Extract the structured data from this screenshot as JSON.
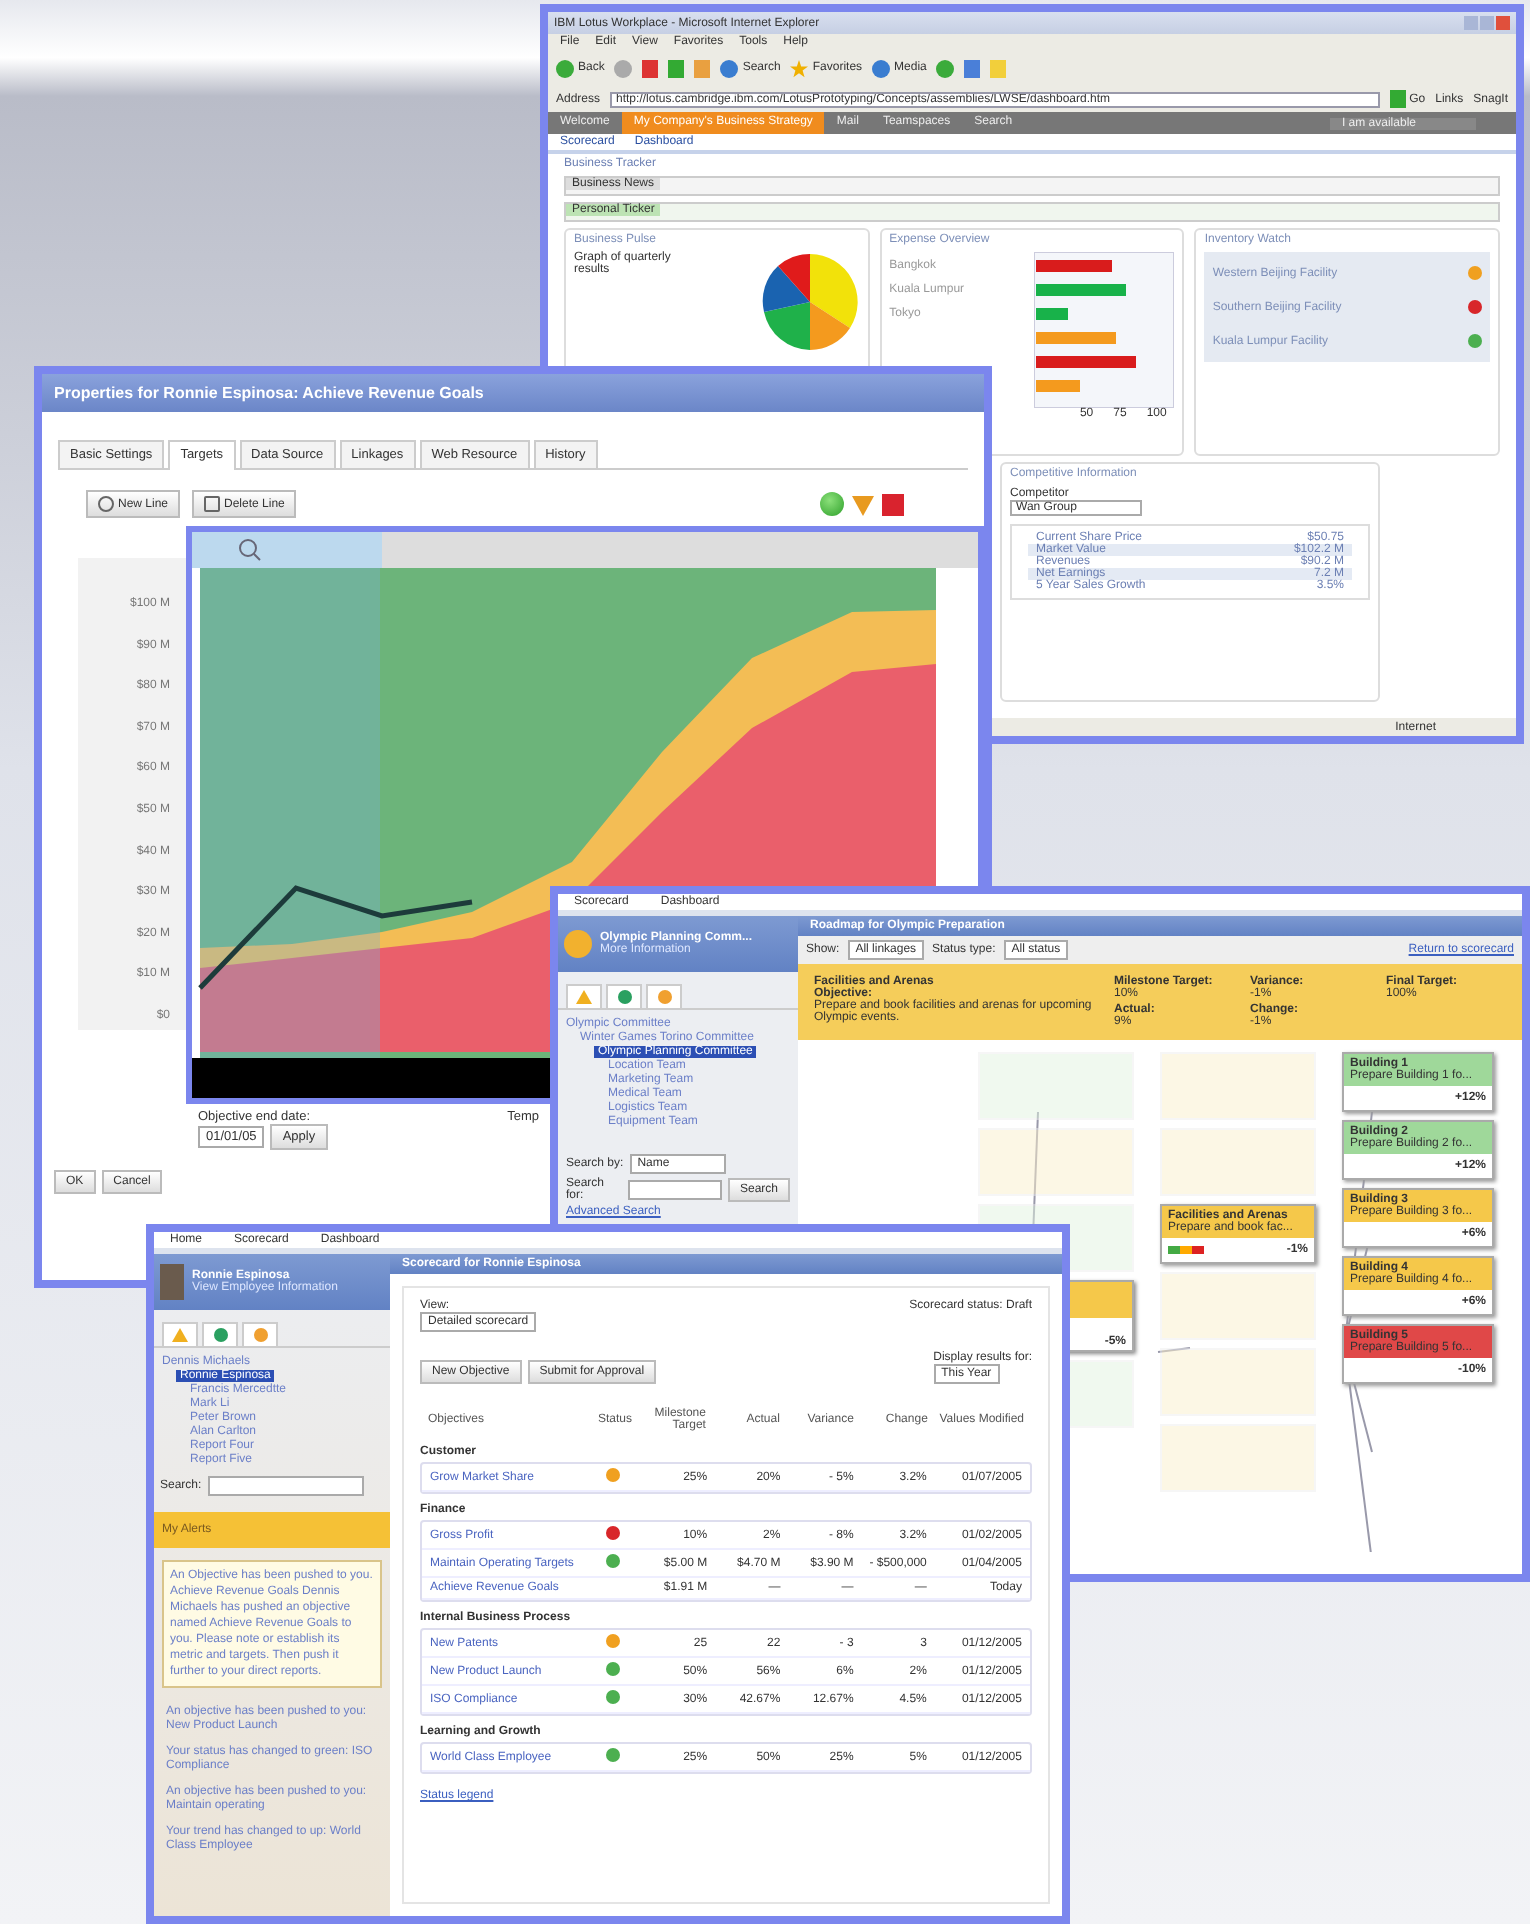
{
  "browser_window": {
    "title": "IBM Lotus Workplace - Microsoft Internet Explorer",
    "menu": [
      "File",
      "Edit",
      "View",
      "Favorites",
      "Tools",
      "Help"
    ],
    "toolbar": [
      "Back",
      "Search",
      "Favorites",
      "Media"
    ],
    "address_label": "Address",
    "address": "http://lotus.cambridge.ibm.com/LotusPrototyping/Concepts/assemblies/LWSE/dashboard.htm",
    "go": "Go",
    "links": "Links",
    "snagit": "SnagIt",
    "nav_tabs": [
      {
        "label": "Welcome",
        "selected": false
      },
      {
        "label": "My Company's Business Strategy",
        "selected": true
      },
      {
        "label": "Mail",
        "selected": false
      },
      {
        "label": "Teamspaces",
        "selected": false
      },
      {
        "label": "Search",
        "selected": false
      }
    ],
    "availability": "I am available",
    "subtabs": [
      "Scorecard",
      "Dashboard"
    ],
    "section": "Business Tracker",
    "news_label": "Business News",
    "ticker_label": "Personal Ticker",
    "portlets": [
      "Business Pulse",
      "Expense Overview",
      "Inventory Watch"
    ],
    "pulse_text": "Graph of quarterly results",
    "expense_labels": [
      "Bangkok",
      "Kuala Lumpur",
      "Tokyo"
    ],
    "expense_ticks": [
      "50",
      "75",
      "100"
    ],
    "inventory": [
      {
        "name": "Western Beijing Facility",
        "color": "#f0a020"
      },
      {
        "name": "Southern Beijing Facility",
        "color": "#d8262a"
      },
      {
        "name": "Kuala Lumpur Facility",
        "color": "#4caf50"
      }
    ],
    "competitive": {
      "title": "Competitive Information",
      "label": "Competitor",
      "value": "Wan Group",
      "rows": [
        {
          "label": "Current Share Price",
          "value": "$50.75"
        },
        {
          "label": "Market Value",
          "value": "$102.2 M"
        },
        {
          "label": "Revenues",
          "value": "$90.2 M"
        },
        {
          "label": "Net Earnings",
          "value": "7.2 M"
        },
        {
          "label": "5 Year Sales Growth",
          "value": "3.5%"
        }
      ]
    },
    "status": "Internet"
  },
  "properties_window": {
    "title": "Properties for Ronnie Espinosa: Achieve Revenue Goals",
    "tabs": [
      {
        "label": "Basic Settings",
        "selected": false
      },
      {
        "label": "Targets",
        "selected": true
      },
      {
        "label": "Data Source",
        "selected": false
      },
      {
        "label": "Linkages",
        "selected": false
      },
      {
        "label": "Web Resource",
        "selected": false
      },
      {
        "label": "History",
        "selected": false
      }
    ],
    "buttons": [
      "New Line",
      "Delete Line"
    ],
    "y_labels": [
      "$100 M",
      "$90 M",
      "$80 M",
      "$70 M",
      "$60 M",
      "$50 M",
      "$40 M",
      "$30 M",
      "$20 M",
      "$10 M",
      "$0"
    ],
    "objective_label": "Objective end date:",
    "objective_date": "01/01/05",
    "apply": "Apply",
    "template_label": "Temp",
    "footer_buttons": [
      "OK",
      "Cancel"
    ]
  },
  "roadmap_window": {
    "nav": [
      "Scorecard",
      "Dashboard"
    ],
    "org": "Olympic Planning Comm...",
    "more": "More Information",
    "tree": [
      {
        "label": "Olympic Committee",
        "selected": false,
        "children": [
          {
            "label": "Winter Games Torino Committee",
            "selected": false,
            "children": [
              {
                "label": "Olympic Planning Committee",
                "selected": true,
                "children": [
                  {
                    "label": "Location Team",
                    "selected": false
                  },
                  {
                    "label": "Marketing Team",
                    "selected": false
                  },
                  {
                    "label": "Medical Team",
                    "selected": false
                  },
                  {
                    "label": "Logistics Team",
                    "selected": false
                  },
                  {
                    "label": "Equipment Team",
                    "selected": false
                  }
                ]
              }
            ]
          }
        ]
      }
    ],
    "search_by_label": "Search by:",
    "search_by": "Name",
    "search_for_label": "Search for:",
    "search_button": "Search",
    "advanced": "Advanced Search",
    "heading": "Roadmap for Olympic Preparation",
    "show_label": "Show:",
    "show": "All linkages",
    "status_label": "Status type:",
    "status": "All status",
    "return": "Return to scorecard",
    "banner": {
      "title": "Facilities and Arenas",
      "objective_label": "Objective:",
      "objective": "Prepare and book facilities and arenas for upcoming Olympic events.",
      "metrics": [
        {
          "label": "Milestone Target:",
          "value": "10%"
        },
        {
          "label": "Variance:",
          "value": "-1%"
        },
        {
          "label": "Final Target:",
          "value": "100%"
        },
        {
          "label": "Actual:",
          "value": "9%"
        },
        {
          "label": "Change:",
          "value": "-1%"
        }
      ]
    },
    "left_node": {
      "value": "-5%"
    },
    "center_node": {
      "title": "Facilities and Arenas",
      "text": "Prepare and book fac...",
      "value": "-1%"
    },
    "nodes": [
      {
        "title": "Building 1",
        "text": "Prepare Building 1 fo...",
        "value": "+12%",
        "color": "#9fd89a"
      },
      {
        "title": "Building 2",
        "text": "Prepare Building 2 fo...",
        "value": "+12%",
        "color": "#9fd89a"
      },
      {
        "title": "Building 3",
        "text": "Prepare Building 3 fo...",
        "value": "+6%",
        "color": "#f5c84a"
      },
      {
        "title": "Building 4",
        "text": "Prepare Building 4 fo...",
        "value": "+6%",
        "color": "#f5c84a"
      },
      {
        "title": "Building 5",
        "text": "Prepare Building 5 fo...",
        "value": "-10%",
        "color": "#e04848"
      }
    ]
  },
  "scorecard_window": {
    "nav": [
      "Home",
      "Scorecard",
      "Dashboard"
    ],
    "user": "Ronnie Espinosa",
    "user_link": "View Employee Information",
    "tree": [
      {
        "label": "Dennis Michaels",
        "selected": false,
        "children": [
          {
            "label": "Ronnie Espinosa",
            "selected": true,
            "children": [
              {
                "label": "Francis Mercedtte",
                "selected": false
              },
              {
                "label": "Mark Li",
                "selected": false
              },
              {
                "label": "Peter Brown",
                "selected": false
              },
              {
                "label": "Alan Carlton",
                "selected": false
              },
              {
                "label": "Report Four",
                "selected": false
              },
              {
                "label": "Report Five",
                "selected": false
              }
            ]
          }
        ]
      }
    ],
    "search_label": "Search:",
    "alerts_title": "My Alerts",
    "alert_main": "An Objective has been pushed to you. Achieve Revenue Goals Dennis Michaels has pushed an objective named Achieve Revenue Goals to you. Please note or establish its metric and targets. Then push it further to your direct reports.",
    "alerts": [
      "An objective has been pushed to you: New Product Launch",
      "Your status has changed to green: ISO Compliance",
      "An objective has been pushed to you: Maintain operating",
      "Your trend has changed to up: World Class Employee"
    ],
    "heading": "Scorecard for Ronnie Espinosa",
    "view_label": "View:",
    "view": "Detailed scorecard",
    "scorecard_status": "Scorecard status: Draft",
    "display_label": "Display results for:",
    "display": "This Year",
    "buttons": [
      "New Objective",
      "Submit for Approval"
    ],
    "columns": [
      "Objectives",
      "Status",
      "Milestone Target",
      "Actual",
      "Variance",
      "Change",
      "Values Modified"
    ],
    "groups": [
      {
        "name": "Customer",
        "rows": [
          {
            "name": "Grow Market Share",
            "color": "#f0a020",
            "cells": [
              "25%",
              "20%",
              "- 5%",
              "3.2%",
              "01/07/2005"
            ]
          }
        ]
      },
      {
        "name": "Finance",
        "rows": [
          {
            "name": "Gross Profit",
            "color": "#d8262a",
            "cells": [
              "10%",
              "2%",
              "- 8%",
              "3.2%",
              "01/02/2005"
            ]
          },
          {
            "name": "Maintain Operating Targets",
            "color": "#4caf50",
            "cells": [
              "$5.00 M",
              "$4.70 M",
              "$3.90 M",
              "- $500,000",
              "01/04/2005"
            ]
          },
          {
            "name": "Achieve Revenue Goals",
            "cells": [
              "$1.91 M",
              "—",
              "—",
              "—",
              "Today"
            ]
          }
        ]
      },
      {
        "name": "Internal Business Process",
        "rows": [
          {
            "name": "New Patents",
            "color": "#f0a020",
            "cells": [
              "25",
              "22",
              "- 3",
              "3",
              "01/12/2005"
            ]
          },
          {
            "name": "New Product Launch",
            "color": "#4caf50",
            "cells": [
              "50%",
              "56%",
              "6%",
              "2%",
              "01/12/2005"
            ]
          },
          {
            "name": "ISO Compliance",
            "color": "#4caf50",
            "cells": [
              "30%",
              "42.67%",
              "12.67%",
              "4.5%",
              "01/12/2005"
            ]
          }
        ]
      },
      {
        "name": "Learning and Growth",
        "rows": [
          {
            "name": "World Class Employee",
            "color": "#4caf50",
            "cells": [
              "25%",
              "50%",
              "25%",
              "5%",
              "01/12/2005"
            ]
          }
        ]
      }
    ],
    "legend": "Status legend"
  }
}
